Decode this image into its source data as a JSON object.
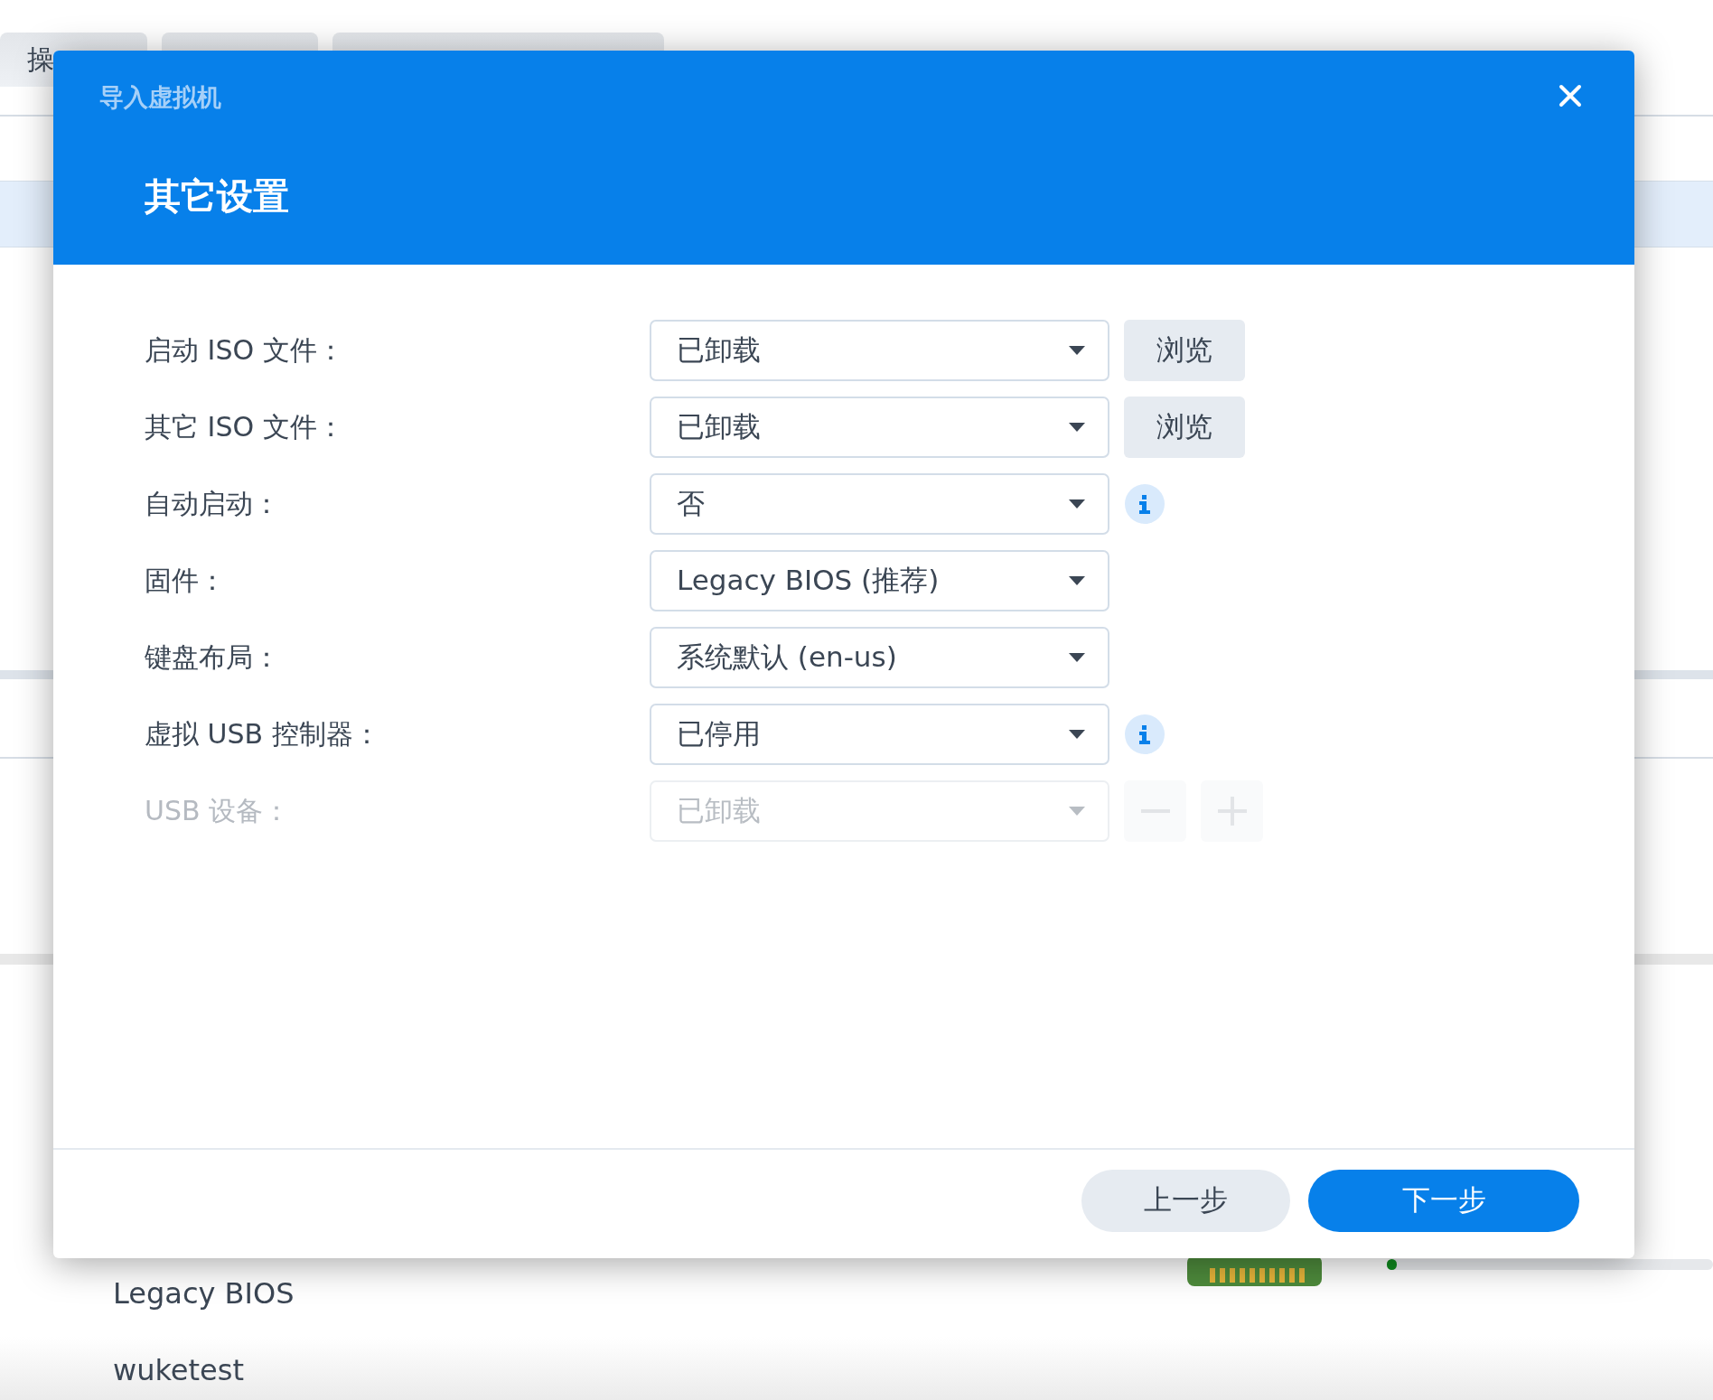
{
  "background": {
    "tab_label": "操",
    "rows": [
      {
        "text": "Legacy BIOS"
      },
      {
        "text": "wuketest"
      }
    ],
    "usage_bar": {
      "level": 0.03
    }
  },
  "dialog": {
    "title": "导入虚拟机",
    "heading": "其它设置",
    "fields": [
      {
        "label": "启动 ISO 文件：",
        "value": "已卸载",
        "disabled": false,
        "kind": "browse",
        "button_label": "浏览"
      },
      {
        "label": "其它 ISO 文件：",
        "value": "已卸载",
        "disabled": false,
        "kind": "browse",
        "button_label": "浏览"
      },
      {
        "label": "自动启动：",
        "value": "否",
        "disabled": false,
        "kind": "info"
      },
      {
        "label": "固件：",
        "value": "Legacy BIOS (推荐)",
        "disabled": false,
        "kind": "plain"
      },
      {
        "label": "键盘布局：",
        "value": "系统默认 (en-us)",
        "disabled": false,
        "kind": "plain"
      },
      {
        "label": "虚拟 USB 控制器：",
        "value": "已停用",
        "disabled": false,
        "kind": "info"
      },
      {
        "label": "USB 设备：",
        "value": "已卸载",
        "disabled": true,
        "kind": "add_remove"
      }
    ],
    "buttons": [
      {
        "label": "上一步",
        "kind": "secondary"
      },
      {
        "label": "下一步",
        "kind": "primary"
      }
    ]
  }
}
